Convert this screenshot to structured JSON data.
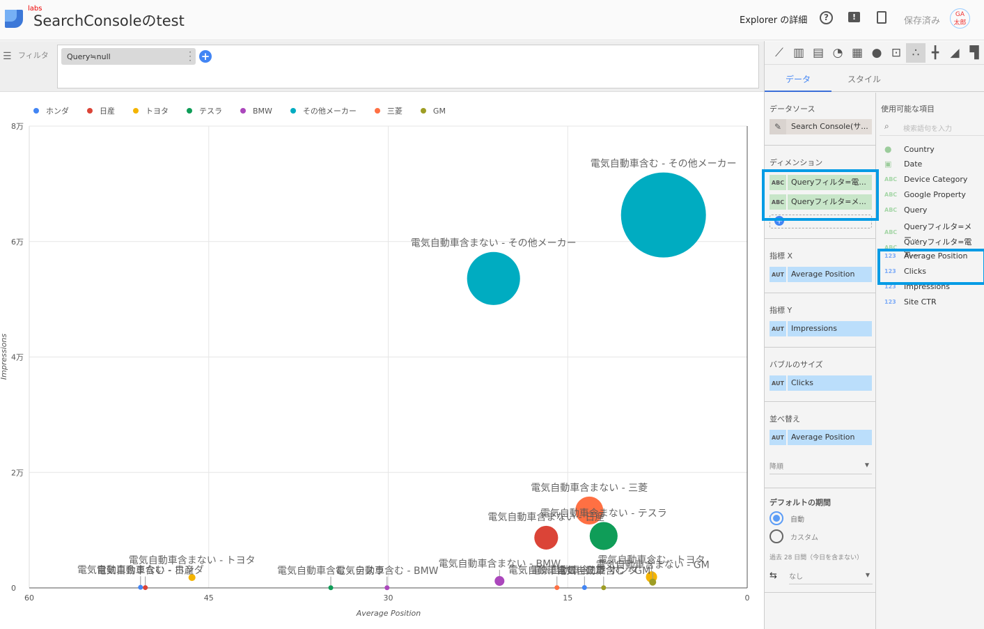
{
  "header": {
    "labs": "labs",
    "title": "SearchConsoleのtest",
    "explorer": "Explorer の詳細",
    "saved": "保存済み",
    "avatar": "GA太郎"
  },
  "filter": {
    "label": "フィルタ",
    "chip": "Query≒null"
  },
  "legend": [
    {
      "name": "ホンダ",
      "color": "#4285f4"
    },
    {
      "name": "日産",
      "color": "#db4437"
    },
    {
      "name": "トヨタ",
      "color": "#f4b400"
    },
    {
      "name": "テスラ",
      "color": "#0f9d58"
    },
    {
      "name": "BMW",
      "color": "#ab47bc"
    },
    {
      "name": "その他メーカー",
      "color": "#00acc1"
    },
    {
      "name": "三菱",
      "color": "#ff7043"
    },
    {
      "name": "GM",
      "color": "#9e9d24"
    }
  ],
  "chart_data": {
    "type": "scatter",
    "bubble": true,
    "xlabel": "Average Position",
    "ylabel": "Impressions",
    "xlim": [
      60,
      0
    ],
    "ylim": [
      0,
      80000
    ],
    "xticks": [
      "60",
      "45",
      "30",
      "15",
      "0"
    ],
    "yticks": [
      "0",
      "2万",
      "4万",
      "6万",
      "8万"
    ],
    "grid": true,
    "legend_position": "top",
    "points": [
      {
        "label": "電気自動車含む - その他メーカー",
        "series": "その他メーカー",
        "x": 7.0,
        "y": 64600,
        "size": 3700
      },
      {
        "label": "電気自動車含まない - その他メーカー",
        "series": "その他メーカー",
        "x": 21.2,
        "y": 53600,
        "size": 1440
      },
      {
        "label": "電気自動車含まない - 三菱",
        "series": "三菱",
        "x": 13.2,
        "y": 13400,
        "size": 400
      },
      {
        "label": "電気自動車含まない - 日産",
        "series": "日産",
        "x": 16.8,
        "y": 8700,
        "size": 290
      },
      {
        "label": "電気自動車含まない - テスラ",
        "series": "テスラ",
        "x": 12.0,
        "y": 9000,
        "size": 400
      },
      {
        "label": "電気自動車含まない - トヨタ",
        "series": "トヨタ",
        "x": 46.4,
        "y": 1800,
        "size": 25
      },
      {
        "label": "電気自動車含む - トヨタ",
        "series": "トヨタ",
        "x": 8.0,
        "y": 1900,
        "size": 64
      },
      {
        "label": "電気自動車含まない - GM",
        "series": "GM",
        "x": 7.9,
        "y": 1000,
        "size": 25
      },
      {
        "label": "電気自動車含まない - BMW",
        "series": "BMW",
        "x": 20.7,
        "y": 1200,
        "size": 49
      },
      {
        "label": "電気自動車含まない - ホンダ",
        "series": "ホンダ",
        "x": 50.7,
        "y": 100,
        "size": 9
      },
      {
        "label": "電気自動車含む - 日産",
        "series": "日産",
        "x": 50.3,
        "y": 50,
        "size": 9
      },
      {
        "label": "電気自動車含む - テスラ",
        "series": "テスラ",
        "x": 34.8,
        "y": 30,
        "size": 9
      },
      {
        "label": "電気自動車含む - BMW",
        "series": "BMW",
        "x": 30.1,
        "y": 30,
        "size": 9
      },
      {
        "label": "電気自動車含む - 三菱",
        "series": "三菱",
        "x": 15.9,
        "y": 50,
        "size": 6
      },
      {
        "label": "電気自動車含む - ホンダ",
        "series": "ホンダ",
        "x": 13.6,
        "y": 60,
        "size": 9
      },
      {
        "label": "電気自動車含む - GM",
        "series": "GM",
        "x": 12.0,
        "y": 30,
        "size": 9
      }
    ]
  },
  "panel": {
    "chart_types": [
      "line-chart-icon",
      "bar-chart-icon",
      "combo-chart-icon",
      "pie-chart-icon",
      "table-icon",
      "geo-map-icon",
      "scorecard-icon",
      "scatter-chart-icon",
      "bullet-icon",
      "area-chart-icon",
      "pivot-icon"
    ],
    "tabs": {
      "data": "データ",
      "style": "スタイル"
    },
    "datasource": {
      "label": "データソース",
      "value": "Search Console(サ..."
    },
    "dimension": {
      "label": "ディメンション",
      "items": [
        "Queryフィルタ=電...",
        "Queryフィルタ=メ..."
      ]
    },
    "metric_x": {
      "label": "指標 X",
      "tag": "AUT",
      "value": "Average Position"
    },
    "metric_y": {
      "label": "指標 Y",
      "tag": "AUT",
      "value": "Impressions"
    },
    "bubble": {
      "label": "バブルのサイズ",
      "tag": "AUT",
      "value": "Clicks"
    },
    "sort": {
      "label": "並べ替え",
      "tag": "AUT",
      "value": "Average Position",
      "order": "降順"
    },
    "period": {
      "label": "デフォルトの期間",
      "auto": "自動",
      "custom": "カスタム",
      "note": "過去 28 日間（今日を含まない）",
      "compare": "なし"
    },
    "fields": {
      "label": "使用可能な項目",
      "search_placeholder": "検索語句を入力",
      "items": [
        {
          "tag": "globe",
          "name": "Country"
        },
        {
          "tag": "cal",
          "name": "Date"
        },
        {
          "tag": "ABC",
          "name": "Device Category"
        },
        {
          "tag": "ABC",
          "name": "Google Property"
        },
        {
          "tag": "ABC",
          "name": "Query"
        },
        {
          "tag": "ABC",
          "name": "Queryフィルタ=メー..."
        },
        {
          "tag": "ABC",
          "name": "Queryフィルタ=電気..."
        },
        {
          "tag": "123",
          "name": "Average Position"
        },
        {
          "tag": "123",
          "name": "Clicks"
        },
        {
          "tag": "123",
          "name": "Impressions"
        },
        {
          "tag": "123",
          "name": "Site CTR"
        }
      ]
    }
  }
}
